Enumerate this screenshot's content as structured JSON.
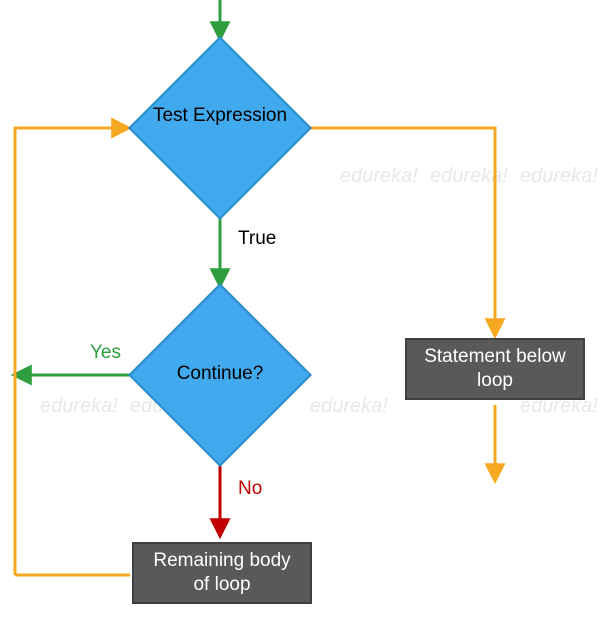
{
  "diagram": {
    "nodes": {
      "test_expression": "Test Expression",
      "continue": "Continue?",
      "statement_below": "Statement below loop",
      "remaining_body": "Remaining body of loop"
    },
    "edges": {
      "true_label": "True",
      "yes_label": "Yes",
      "no_label": "No"
    },
    "colors": {
      "diamond_fill": "#41aaee",
      "diamond_border": "#2a8cc9",
      "rect_fill": "#595959",
      "rect_border": "#404040",
      "arrow_green": "#2e9e3f",
      "arrow_orange": "#f7a823",
      "arrow_red": "#c00000",
      "label_true": "#000000",
      "label_yes": "#2e9e3f",
      "label_no": "#c00000"
    },
    "watermark_text": "edureka!"
  },
  "chart_data": {
    "type": "flowchart",
    "title": "",
    "nodes": [
      {
        "id": "start",
        "type": "start",
        "label": ""
      },
      {
        "id": "test_expression",
        "type": "decision",
        "label": "Test Expression"
      },
      {
        "id": "continue",
        "type": "decision",
        "label": "Continue?"
      },
      {
        "id": "remaining_body",
        "type": "process",
        "label": "Remaining body of loop"
      },
      {
        "id": "statement_below",
        "type": "process",
        "label": "Statement below loop"
      },
      {
        "id": "end",
        "type": "end",
        "label": ""
      }
    ],
    "edges": [
      {
        "from": "start",
        "to": "test_expression",
        "label": "",
        "color": "green"
      },
      {
        "from": "test_expression",
        "to": "continue",
        "label": "True",
        "color": "green"
      },
      {
        "from": "test_expression",
        "to": "statement_below",
        "label": "",
        "color": "orange",
        "meaning": "false branch"
      },
      {
        "from": "statement_below",
        "to": "end",
        "label": "",
        "color": "orange"
      },
      {
        "from": "continue",
        "to": "test_expression",
        "label": "Yes",
        "color": "green",
        "meaning": "loop back"
      },
      {
        "from": "continue",
        "to": "remaining_body",
        "label": "No",
        "color": "red"
      },
      {
        "from": "remaining_body",
        "to": "test_expression",
        "label": "",
        "color": "orange",
        "meaning": "loop back"
      }
    ]
  }
}
